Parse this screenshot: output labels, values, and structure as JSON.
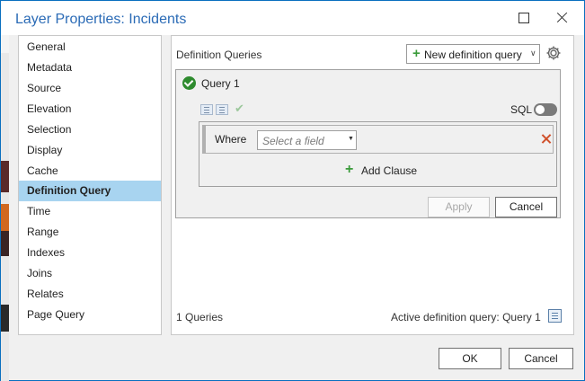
{
  "window": {
    "title": "Layer Properties: Incidents"
  },
  "nav": {
    "items": [
      {
        "label": "General"
      },
      {
        "label": "Metadata"
      },
      {
        "label": "Source"
      },
      {
        "label": "Elevation"
      },
      {
        "label": "Selection"
      },
      {
        "label": "Display"
      },
      {
        "label": "Cache"
      },
      {
        "label": "Definition Query",
        "selected": true
      },
      {
        "label": "Time"
      },
      {
        "label": "Range"
      },
      {
        "label": "Indexes"
      },
      {
        "label": "Joins"
      },
      {
        "label": "Relates"
      },
      {
        "label": "Page Query"
      }
    ]
  },
  "definition_queries": {
    "section_label": "Definition Queries",
    "new_query_button": "New definition query",
    "query": {
      "name": "Query 1",
      "status_icon": "check-circle-icon",
      "sql_label": "SQL",
      "sql_enabled": false,
      "clause": {
        "where_label": "Where",
        "field_placeholder": "Select a field"
      },
      "add_clause_label": "Add Clause",
      "apply_label": "Apply",
      "apply_enabled": false,
      "cancel_label": "Cancel"
    },
    "count_label": "1 Queries",
    "active_label": "Active definition query: Query 1"
  },
  "footer": {
    "ok_label": "OK",
    "cancel_label": "Cancel"
  },
  "colors": {
    "title": "#2b6bb6",
    "nav_selected": "#a8d4f0",
    "add_green": "#3b9b3b",
    "remove_red": "#d0502a",
    "check_green": "#2e8b2e"
  }
}
